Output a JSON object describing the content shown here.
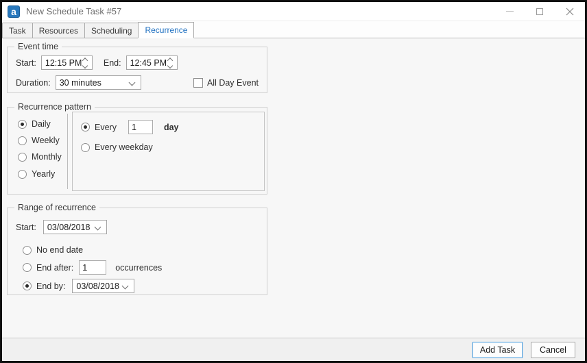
{
  "window": {
    "title": "New Schedule Task #57",
    "app_icon_glyph": "a"
  },
  "tabs": [
    {
      "label": "Task",
      "active": false
    },
    {
      "label": "Resources",
      "active": false
    },
    {
      "label": "Scheduling",
      "active": false
    },
    {
      "label": "Recurrence",
      "active": true
    }
  ],
  "event_time": {
    "legend": "Event time",
    "start_label": "Start:",
    "start_value": "12:15 PM",
    "end_label": "End:",
    "end_value": "12:45 PM",
    "duration_label": "Duration:",
    "duration_value": "30 minutes",
    "all_day_label": "All Day Event",
    "all_day_checked": false
  },
  "recurrence_pattern": {
    "legend": "Recurrence pattern",
    "frequencies": [
      {
        "label": "Daily",
        "selected": true
      },
      {
        "label": "Weekly",
        "selected": false
      },
      {
        "label": "Monthly",
        "selected": false
      },
      {
        "label": "Yearly",
        "selected": false
      }
    ],
    "every_label": "Every",
    "every_value": "1",
    "every_unit": "day",
    "every_selected": true,
    "weekday_label": "Every weekday",
    "weekday_selected": false
  },
  "range_of_recurrence": {
    "legend": "Range of recurrence",
    "start_label": "Start:",
    "start_value": "03/08/2018",
    "no_end_label": "No end date",
    "no_end_selected": false,
    "end_after_label": "End after:",
    "end_after_value": "1",
    "occurrences_label": "occurrences",
    "end_after_selected": false,
    "end_by_label": "End by:",
    "end_by_value": "03/08/2018",
    "end_by_selected": true
  },
  "footer": {
    "add_label": "Add Task",
    "cancel_label": "Cancel"
  },
  "colors": {
    "active_tab_blue": "#1d6fc0",
    "add_button_border": "#3a96dd",
    "app_icon_blue": "#2878bd",
    "window_border": "#101010"
  }
}
